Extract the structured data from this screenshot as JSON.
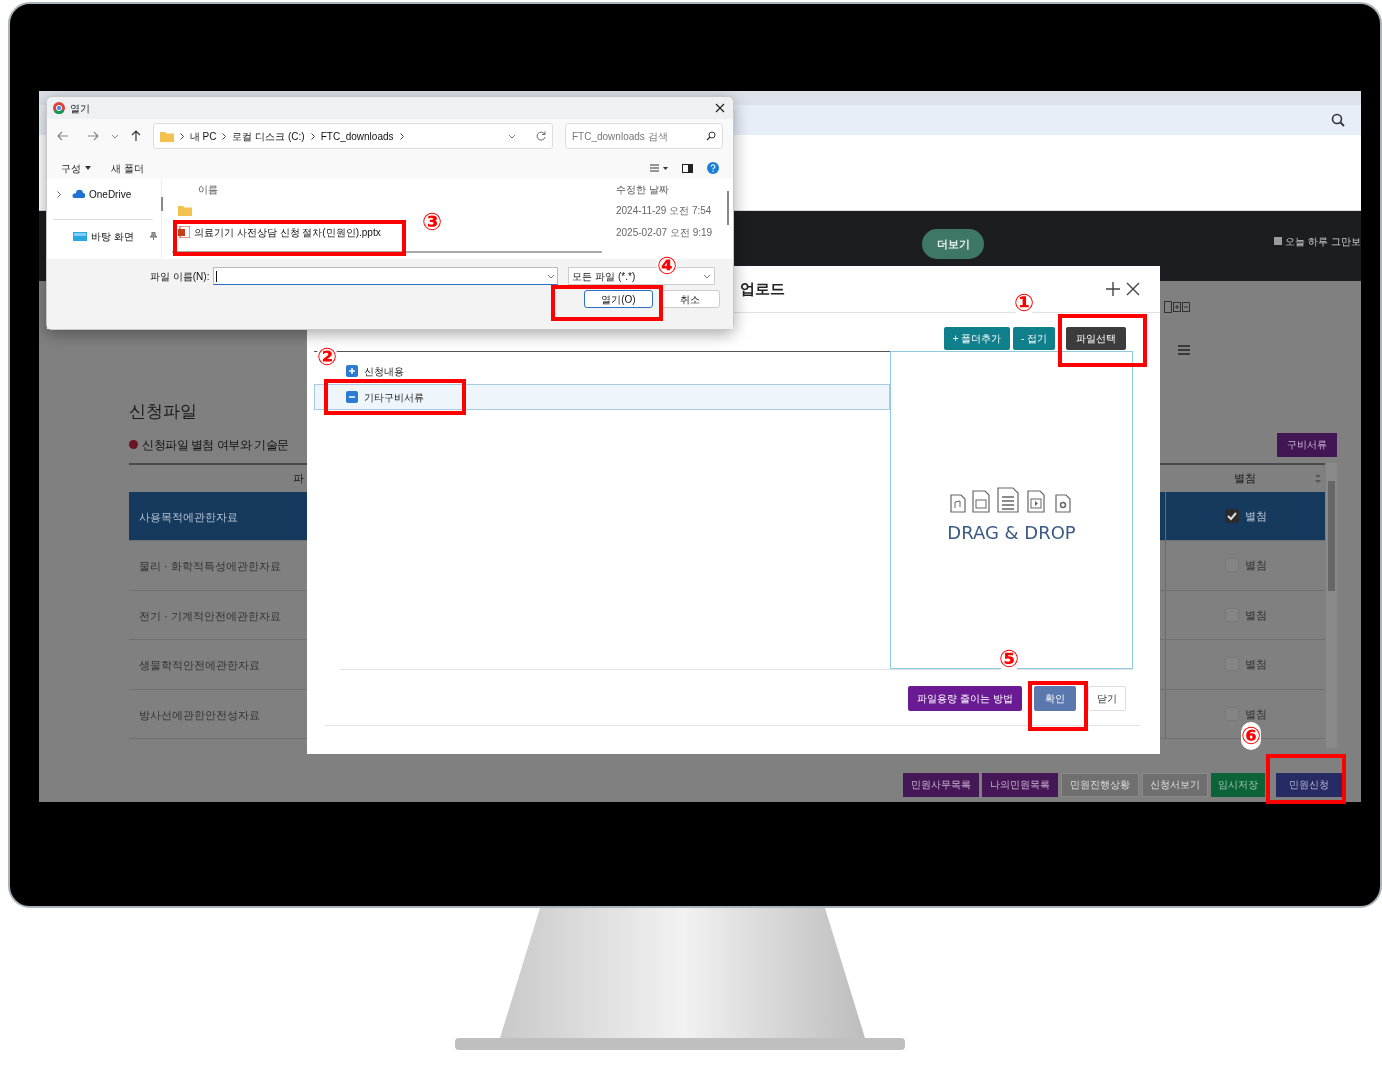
{
  "banner": {
    "more_button": "더보기",
    "dismiss_label": "오늘 하루 그만보",
    "dismiss_checked": false
  },
  "page": {
    "title": "신청파일",
    "notice": "신청파일 별첨 여부와 기술문",
    "docs_button": "구비서류",
    "columns": [
      "파",
      "별첨"
    ],
    "rows": [
      {
        "name": "사용목적에관한자료",
        "attach": "별첨",
        "checked": true,
        "selected": true
      },
      {
        "name": "물리 · 화학적특성에관한자료",
        "attach": "별첨",
        "checked": false,
        "selected": false
      },
      {
        "name": "전기 · 기계적안전에관한자료",
        "attach": "별첨",
        "checked": false,
        "selected": false
      },
      {
        "name": "생물학적안전에관한자료",
        "attach": "별첨",
        "checked": false,
        "selected": false
      },
      {
        "name": "방사선에관한안전성자료",
        "attach": "별첨",
        "checked": false,
        "selected": false
      }
    ],
    "footer_buttons": [
      {
        "label": "민원사무목록",
        "kind": "menu"
      },
      {
        "label": "나의민원목록",
        "kind": "menu"
      },
      {
        "label": "민원진행상황",
        "kind": "inactive"
      },
      {
        "label": "신청서보기",
        "kind": "inactive"
      },
      {
        "label": "임시저장",
        "kind": "save"
      },
      {
        "label": "민원신청",
        "kind": "submit"
      }
    ]
  },
  "upload_dialog": {
    "title": "업로드",
    "toolbar_buttons": [
      {
        "label": "+ 폴더추가",
        "kind": "teal"
      },
      {
        "label": "- 접기",
        "kind": "teal"
      },
      {
        "label": "파일선택",
        "kind": "dark"
      }
    ],
    "tree": [
      {
        "label": "신청내용",
        "expanded": false,
        "selected": false
      },
      {
        "label": "기타구비서류",
        "expanded": true,
        "selected": true
      }
    ],
    "dropzone_text": "DRAG & DROP",
    "footer_buttons": [
      {
        "label": "파일용량 줄이는 방법",
        "kind": "help"
      },
      {
        "label": "확인",
        "kind": "confirm"
      },
      {
        "label": "닫기",
        "kind": "close"
      }
    ]
  },
  "file_dialog": {
    "title": "열기",
    "path": [
      "내 PC",
      "로컬 디스크 (C:)",
      "FTC_downloads"
    ],
    "search_placeholder": "FTC_downloads 검색",
    "organize": "구성",
    "new_folder": "새 폴더",
    "nav": [
      {
        "label": "OneDrive",
        "kind": "cloud"
      },
      {
        "label": "바탕 화면",
        "kind": "desktop"
      }
    ],
    "columns": [
      "이름",
      "수정한 날짜"
    ],
    "files": [
      {
        "kind": "folder",
        "modified": "2024-11-29 오전 7:54"
      },
      {
        "kind": "pptx",
        "name": "의료기기 사전상담 신청 절차(민원인).pptx",
        "modified": "2025-02-07 오전 9:19"
      }
    ],
    "filename_label": "파일 이름(N):",
    "filter": "모든 파일 (*.*)",
    "open_button": "열기(O)",
    "cancel_button": "취소"
  },
  "annotations": [
    {
      "number": "①"
    },
    {
      "number": "②"
    },
    {
      "number": "③"
    },
    {
      "number": "④"
    },
    {
      "number": "⑤"
    },
    {
      "number": "⑥"
    }
  ]
}
